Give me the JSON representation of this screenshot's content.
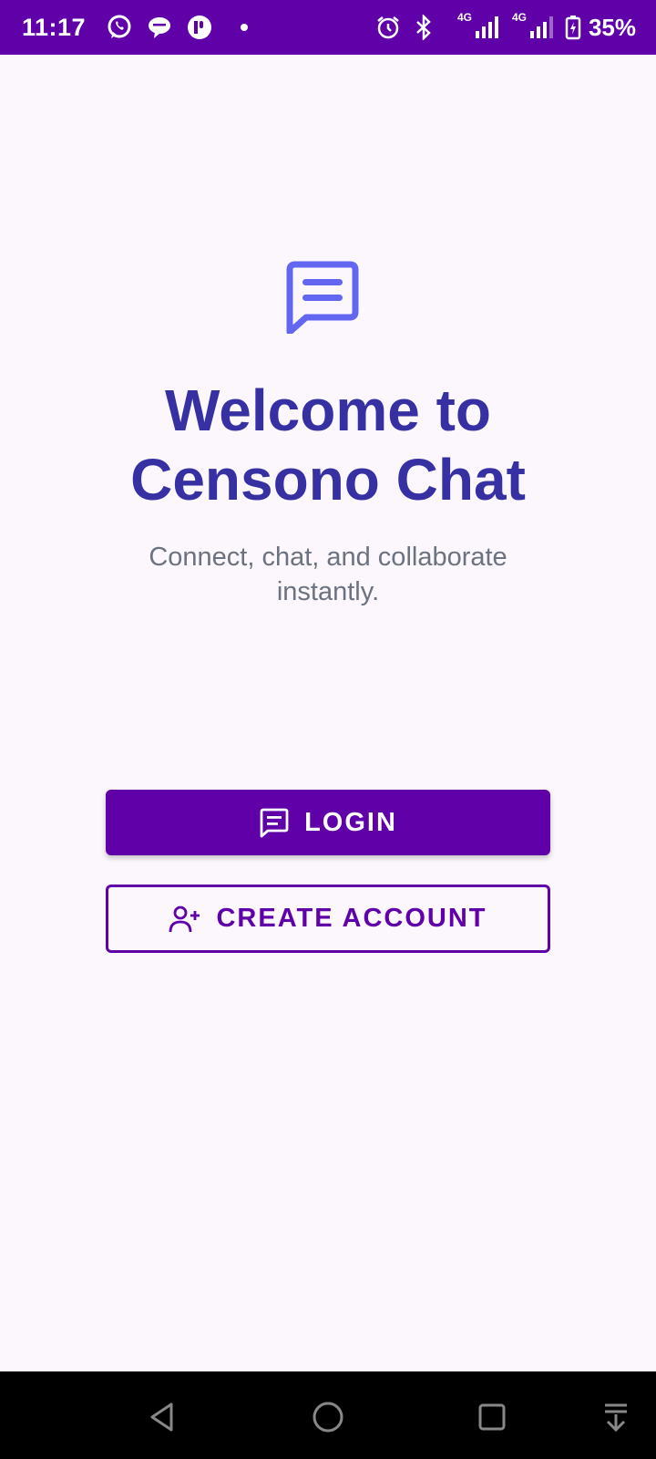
{
  "status_bar": {
    "time": "11:17",
    "network_1": "4G",
    "network_2": "4G",
    "battery": "35%",
    "icons": [
      "whatsapp-icon",
      "chat-bubble-icon",
      "app-icon",
      "alarm-icon",
      "bluetooth-icon",
      "signal-icon",
      "battery-charging-icon"
    ]
  },
  "welcome": {
    "icon": "message-icon",
    "title_line1": "Welcome to",
    "title_line2": "Censono Chat",
    "subtitle_line1": "Connect, chat, and collaborate",
    "subtitle_line2": "instantly."
  },
  "actions": {
    "login_label": "LOGIN",
    "login_icon": "message-icon",
    "create_account_label": "CREATE ACCOUNT",
    "create_account_icon": "add-user-icon"
  },
  "nav_bar": {
    "icons": [
      "back-icon",
      "home-icon",
      "recents-icon",
      "keyboard-hide-icon"
    ]
  },
  "colors": {
    "primary": "#6000A8",
    "title": "#3730A3",
    "hero_icon": "#6366F1",
    "subtitle": "#6B7280",
    "background": "#FBF7FC"
  }
}
